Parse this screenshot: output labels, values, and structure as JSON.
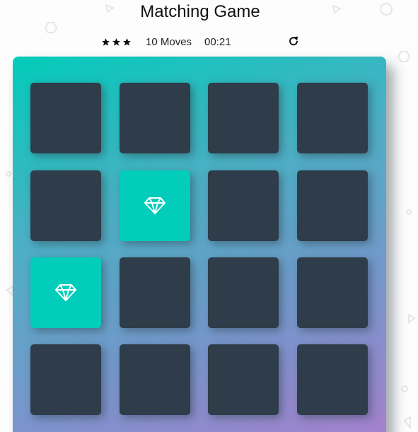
{
  "header": {
    "title": "Matching Game"
  },
  "score_panel": {
    "stars_rating": 3,
    "moves_label": "10 Moves",
    "timer": "00:21",
    "restart_icon": "restart-icon"
  },
  "deck": {
    "rows": 4,
    "columns": 4,
    "cards": [
      {
        "state": "closed",
        "icon": ""
      },
      {
        "state": "closed",
        "icon": ""
      },
      {
        "state": "closed",
        "icon": ""
      },
      {
        "state": "closed",
        "icon": ""
      },
      {
        "state": "closed",
        "icon": ""
      },
      {
        "state": "open",
        "icon": "diamond-icon"
      },
      {
        "state": "closed",
        "icon": ""
      },
      {
        "state": "closed",
        "icon": ""
      },
      {
        "state": "open",
        "icon": "diamond-icon"
      },
      {
        "state": "closed",
        "icon": ""
      },
      {
        "state": "closed",
        "icon": ""
      },
      {
        "state": "closed",
        "icon": ""
      },
      {
        "state": "closed",
        "icon": ""
      },
      {
        "state": "closed",
        "icon": ""
      },
      {
        "state": "closed",
        "icon": ""
      },
      {
        "state": "closed",
        "icon": ""
      }
    ]
  },
  "colors": {
    "card_closed": "#2e3d49",
    "card_open": "#02ccba",
    "deck_gradient_start": "#02ccba",
    "deck_gradient_end": "#aa7ecd"
  }
}
